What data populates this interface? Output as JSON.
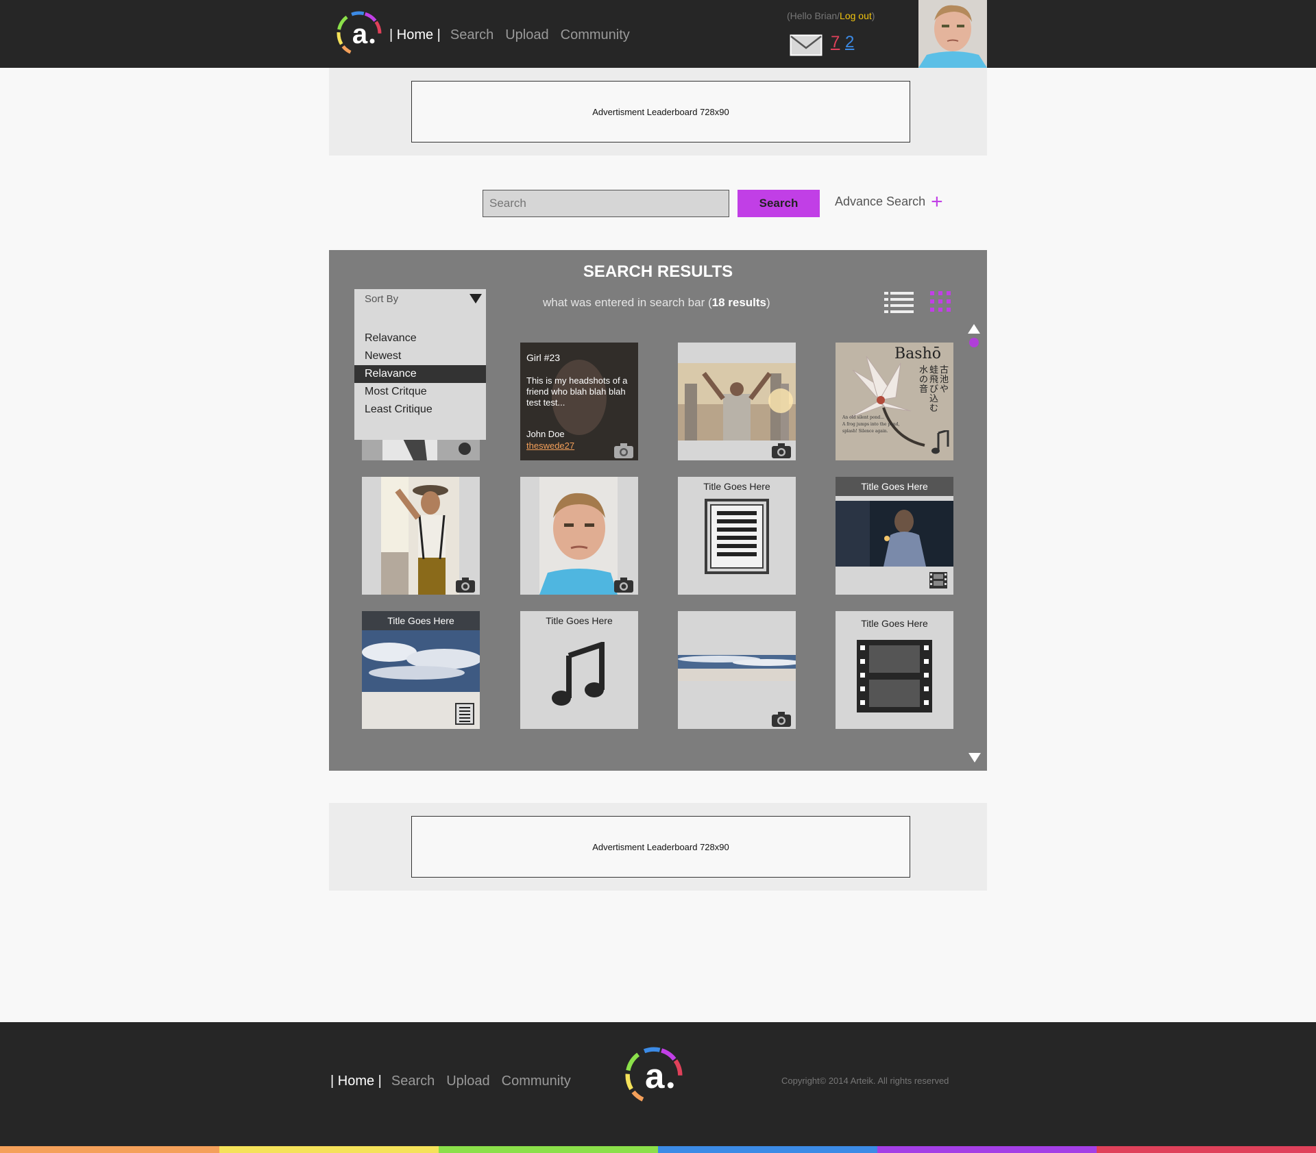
{
  "header": {
    "nav": {
      "home": "| Home |",
      "search": "Search",
      "upload": "Upload",
      "community": "Community"
    },
    "greeting_prefix": "(Hello Brian/",
    "logout": "Log out",
    "greeting_suffix": ")",
    "notif_red": "7",
    "notif_blue": "2",
    "logo_icon": "arteik-logo-icon",
    "mail_icon": "envelope-icon"
  },
  "ads": {
    "top": "Advertisment  Leaderboard 728x90",
    "bottom": "Advertisment  Leaderboard 728x90"
  },
  "search": {
    "placeholder": "Search",
    "button": "Search",
    "advanced": "Advance Search",
    "advanced_icon": "plus-icon"
  },
  "results": {
    "title": "SEARCH RESULTS",
    "query_text": "what was entered in search bar (",
    "count": "18 results",
    "query_close": ")",
    "sort": {
      "label": "Sort By",
      "options": [
        "Relavance",
        "Newest",
        "Relavance",
        "Most Critque",
        "Least Critique"
      ],
      "active_index": 2
    },
    "hover_card": {
      "title": "Girl #23",
      "description": "This is my headshots of a friend who blah blah blah  test test...",
      "author": "John Doe",
      "username": "theswede27"
    },
    "tiles": {
      "basho_title": "Bashō",
      "basho_kanji_1": "古池や",
      "basho_kanji_2": "蛙飛び込む",
      "basho_kanji_3": "水の音",
      "basho_en_1": "An old silent pond...",
      "basho_en_2": "A frog jumps into the pond,",
      "basho_en_3": "splash! Silence again.",
      "doc_title": "Title Goes Here",
      "film_title": "Title Goes Here",
      "sky_title": "Title Goes Here",
      "music_title": "Title Goes Here",
      "video_title": "Title Goes Here"
    }
  },
  "footer": {
    "nav": {
      "home": "| Home |",
      "search": "Search",
      "upload": "Upload",
      "community": "Community"
    },
    "copyright": "Copyright© 2014 Arteik. All rights reserved"
  },
  "colors": {
    "accent": "#c13fe6",
    "header_bg": "#262626",
    "panel_bg": "#7d7d7d",
    "stripe": [
      "#f4a05a",
      "#f5e25a",
      "#8be04a",
      "#3c8be6",
      "#a43fe6",
      "#e0415a"
    ]
  }
}
